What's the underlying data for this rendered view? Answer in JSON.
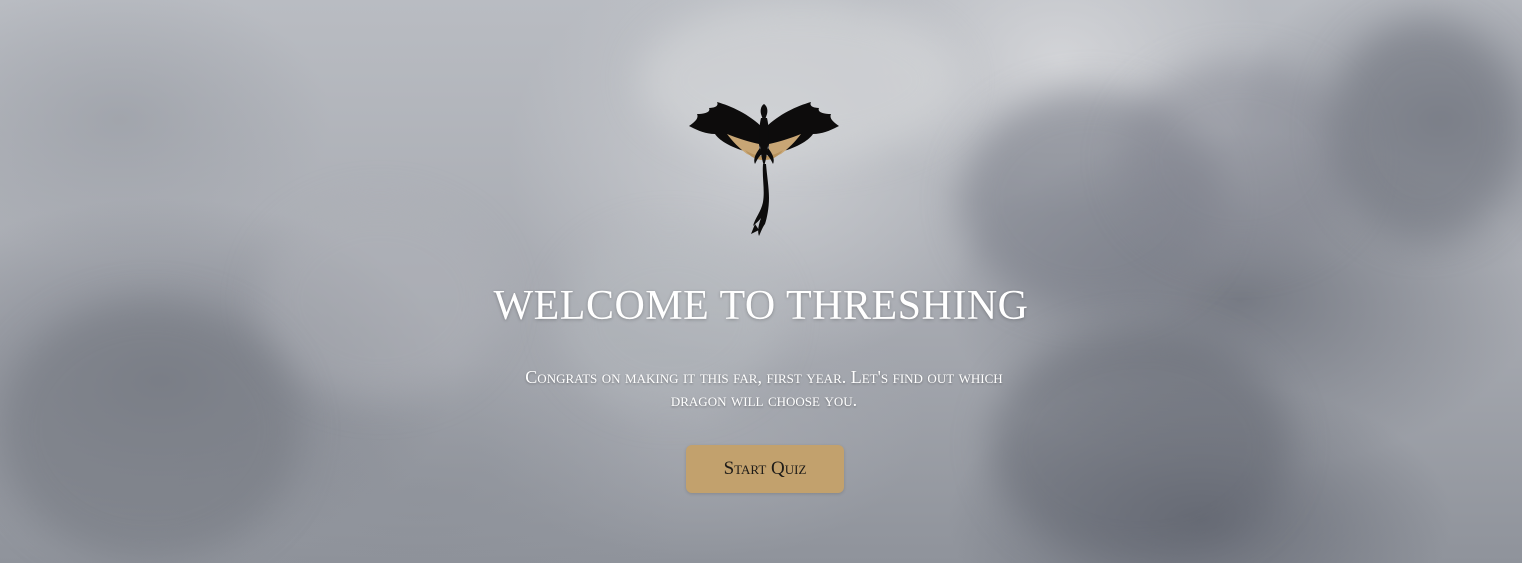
{
  "hero": {
    "logo_icon": "dragon-icon",
    "title": "WELCOME TO THRESHING",
    "subtitle": "Congrats on making it this far, first year. Let's find out which dragon will choose you.",
    "start_button_label": "Start Quiz"
  },
  "colors": {
    "button_bg": "#c2a16d",
    "button_text": "#1d1b18",
    "text": "#ffffff",
    "dragon_body": "#0d0c0c",
    "dragon_wing_inner": "#c8a675"
  }
}
